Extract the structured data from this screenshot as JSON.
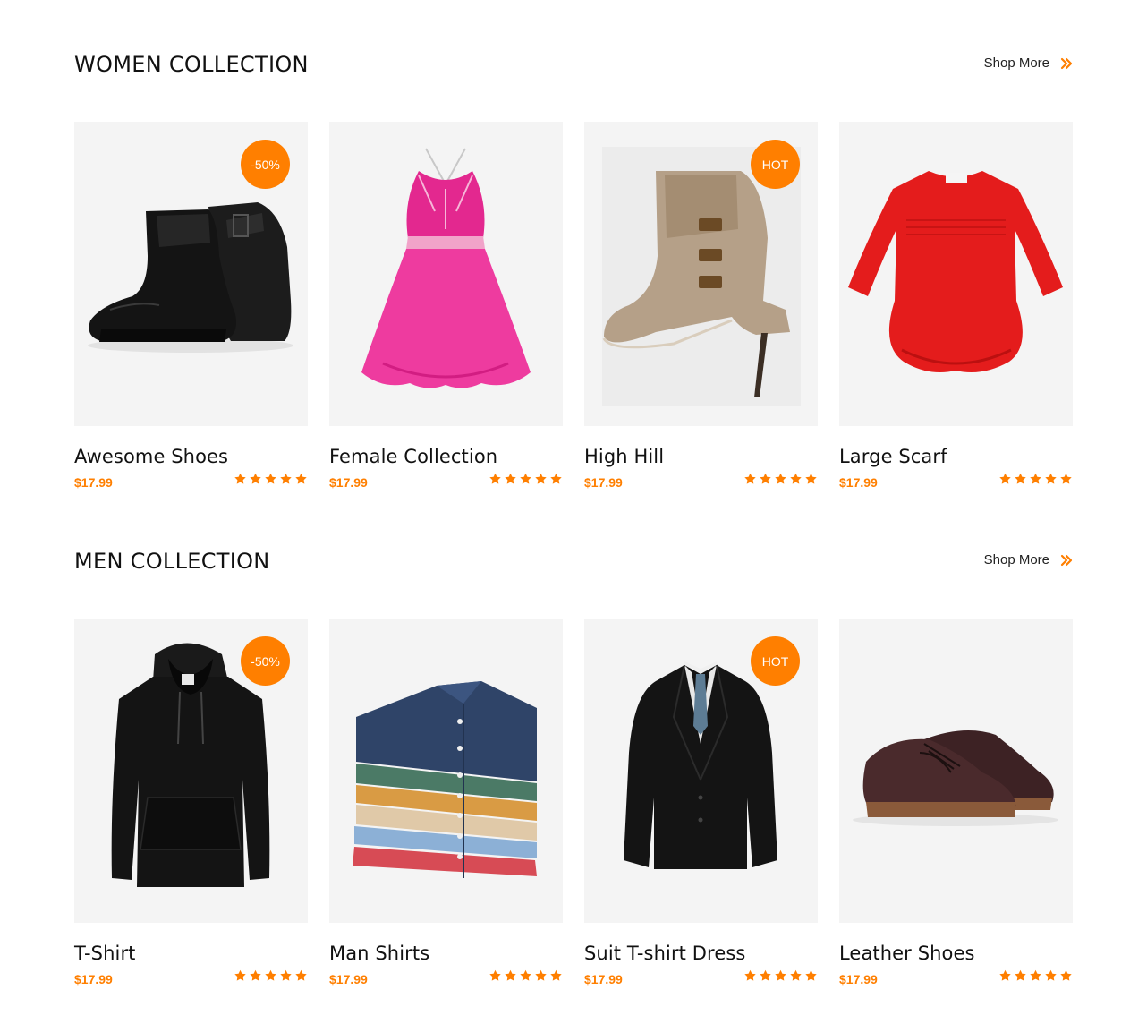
{
  "accent_color": "#ff7f00",
  "women": {
    "title": "WOMEN COLLECTION",
    "shop_more": "Shop More",
    "products": [
      {
        "name": "Awesome Shoes",
        "price": "$17.99",
        "badge": "-50%",
        "rating": 5,
        "image": "black-ankle-boot"
      },
      {
        "name": "Female Collection",
        "price": "$17.99",
        "badge": "",
        "rating": 5,
        "image": "pink-dress"
      },
      {
        "name": "High Hill",
        "price": "$17.99",
        "badge": "HOT",
        "rating": 5,
        "image": "beige-high-heel"
      },
      {
        "name": "Large Scarf",
        "price": "$17.99",
        "badge": "",
        "rating": 5,
        "image": "red-baby-dress"
      }
    ]
  },
  "men": {
    "title": "MEN COLLECTION",
    "shop_more": "Shop More",
    "products": [
      {
        "name": "T-Shirt",
        "price": "$17.99",
        "badge": "-50%",
        "rating": 5,
        "image": "black-hoodie"
      },
      {
        "name": "Man Shirts",
        "price": "$17.99",
        "badge": "",
        "rating": 5,
        "image": "folded-shirts"
      },
      {
        "name": "Suit T-shirt Dress",
        "price": "$17.99",
        "badge": "HOT",
        "rating": 5,
        "image": "black-suit"
      },
      {
        "name": "Leather Shoes",
        "price": "$17.99",
        "badge": "",
        "rating": 5,
        "image": "brown-leather-shoes"
      }
    ]
  }
}
